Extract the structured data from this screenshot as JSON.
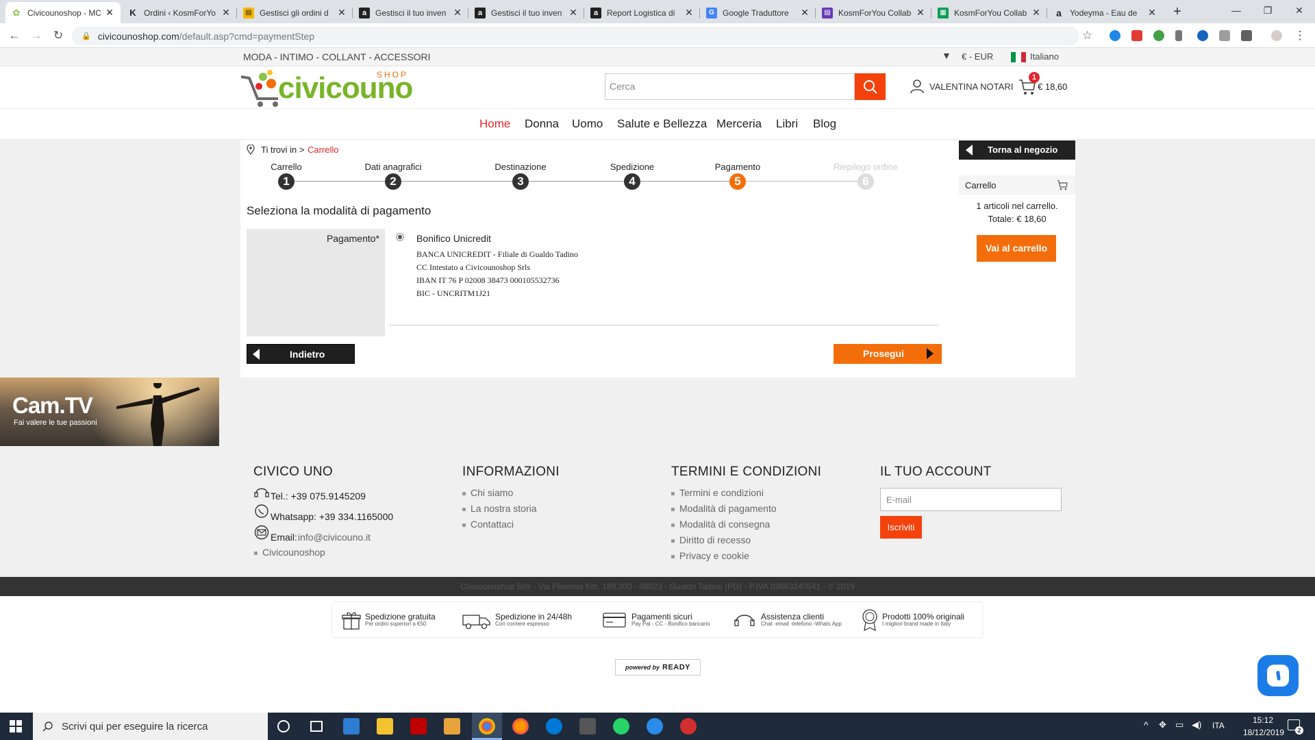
{
  "browser": {
    "tabs": [
      {
        "title": "Civicounoshop - MC",
        "icon": "civicouno-favicon",
        "active": true
      },
      {
        "title": "Ordini ‹ KosmForYo",
        "icon": "k-favicon",
        "active": false
      },
      {
        "title": "Gestisci gli ordini d",
        "icon": "amazon-seller-favicon",
        "active": false
      },
      {
        "title": "Gestisci il tuo inven",
        "icon": "amazon-favicon",
        "active": false
      },
      {
        "title": "Gestisci il tuo inven",
        "icon": "amazon-favicon",
        "active": false
      },
      {
        "title": "Report Logistica di",
        "icon": "amazon-favicon",
        "active": false
      },
      {
        "title": "Google Traduttore",
        "icon": "google-translate-favicon",
        "active": false
      },
      {
        "title": "KosmForYou Collab",
        "icon": "google-forms-favicon",
        "active": false
      },
      {
        "title": "KosmForYou Collab",
        "icon": "google-sheets-favicon",
        "active": false
      },
      {
        "title": "Yodeyma - Eau de",
        "icon": "amazon-favicon",
        "active": false
      }
    ],
    "new_tab": "+",
    "url_host": "civicounoshop.com",
    "url_path": "/default.asp?cmd=paymentStep"
  },
  "topstrip": {
    "categories": "MODA - INTIMO - COLLANT - ACCESSORI",
    "currency": "€ - EUR",
    "language": "Italiano"
  },
  "header": {
    "logo_text": "civicouno",
    "logo_sub": "SHOP",
    "search_placeholder": "Cerca",
    "user_name": "VALENTINA NOTARI",
    "cart_count": "1",
    "cart_total": "€ 18,60"
  },
  "nav": [
    "Home",
    "Donna",
    "Uomo",
    "Salute e Bellezza",
    "Merceria",
    "Libri",
    "Blog"
  ],
  "breadcrumb": {
    "prefix": "Ti trovi in >",
    "current": "Carrello"
  },
  "steps": [
    {
      "label": "Carrello",
      "num": "1"
    },
    {
      "label": "Dati anagrafici",
      "num": "2"
    },
    {
      "label": "Destinazione",
      "num": "3"
    },
    {
      "label": "Spedizione",
      "num": "4"
    },
    {
      "label": "Pagamento",
      "num": "5"
    },
    {
      "label": "Riepilogo ordine",
      "num": "6"
    }
  ],
  "payment": {
    "heading": "Seleziona la modalità di pagamento",
    "label": "Pagamento*",
    "method": "Bonifico Unicredit",
    "details": [
      "BANCA UNICREDIT - Filiale di Gualdo Tadino",
      "CC Intestato a Civicounoshop Srls",
      "IBAN IT 76 P 02008 38473 000105532736",
      "BIC  - UNCRITM1J21"
    ],
    "back_label": "Indietro",
    "next_label": "Prosegui"
  },
  "sidebar": {
    "back_to_shop": "Torna al negozio",
    "cart_title": "Carrello",
    "cart_items": "1 articoli nel carrello.",
    "cart_total": "Totale: € 18,60",
    "go_to_cart": "Vai al carrello"
  },
  "banner": {
    "title": "Cam.TV",
    "subtitle": "Fai valere le tue passioni"
  },
  "footer": {
    "col1": {
      "title": "CIVICO UNO",
      "tel": "Tel.: +39 075.9145209",
      "whatsapp": "Whatsapp: +39 334.1165000",
      "email_prefix": "Email:",
      "email": "info@civicouno.it",
      "link": "Civicounoshop"
    },
    "col2": {
      "title": "INFORMAZIONI",
      "links": [
        "Chi siamo",
        "La nostra storia",
        "Contattaci"
      ]
    },
    "col3": {
      "title": "TERMINI E CONDIZIONI",
      "links": [
        "Termini e condizioni",
        "Modalità di pagamento",
        "Modalità di consegna",
        "Diritto di recesso",
        "Privacy e cookie"
      ]
    },
    "col4": {
      "title": "IL TUO ACCOUNT",
      "email_placeholder": "E-mail",
      "subscribe": "Iscriviti"
    },
    "copyright": "Civicounoshop Srls - Via Flaminia Km. 189,200 - 06023 - Gualdo Tadino (PG) - P.IVA 03663240541 - © 2019",
    "features": [
      {
        "title": "Spedizione gratuita",
        "sub": "Per ordini superiori a €50",
        "icon": "gift-icon"
      },
      {
        "title": "Spedizione in 24/48h",
        "sub": "Con corriere espresso",
        "icon": "truck-icon"
      },
      {
        "title": "Pagamenti sicuri",
        "sub": "Pay Pal - CC - Bonifico bancario",
        "icon": "card-icon"
      },
      {
        "title": "Assistenza clienti",
        "sub": "Chat -email -telefono -Whats App",
        "icon": "headset-icon"
      },
      {
        "title": "Prodotti 100% originali",
        "sub": "I migliori brand made in Italy",
        "icon": "badge-icon"
      }
    ],
    "powered_by": "powered by",
    "powered_brand": "READY"
  },
  "taskbar": {
    "search_placeholder": "Scrivi qui per eseguire la ricerca",
    "lang": "ITA",
    "time": "15:12",
    "date": "18/12/2019",
    "notif_count": "2"
  },
  "colors": {
    "brand_orange": "#f36d0a",
    "search_red": "#f4420c",
    "active_nav": "#e3262c",
    "dark": "#1f1f1f"
  }
}
